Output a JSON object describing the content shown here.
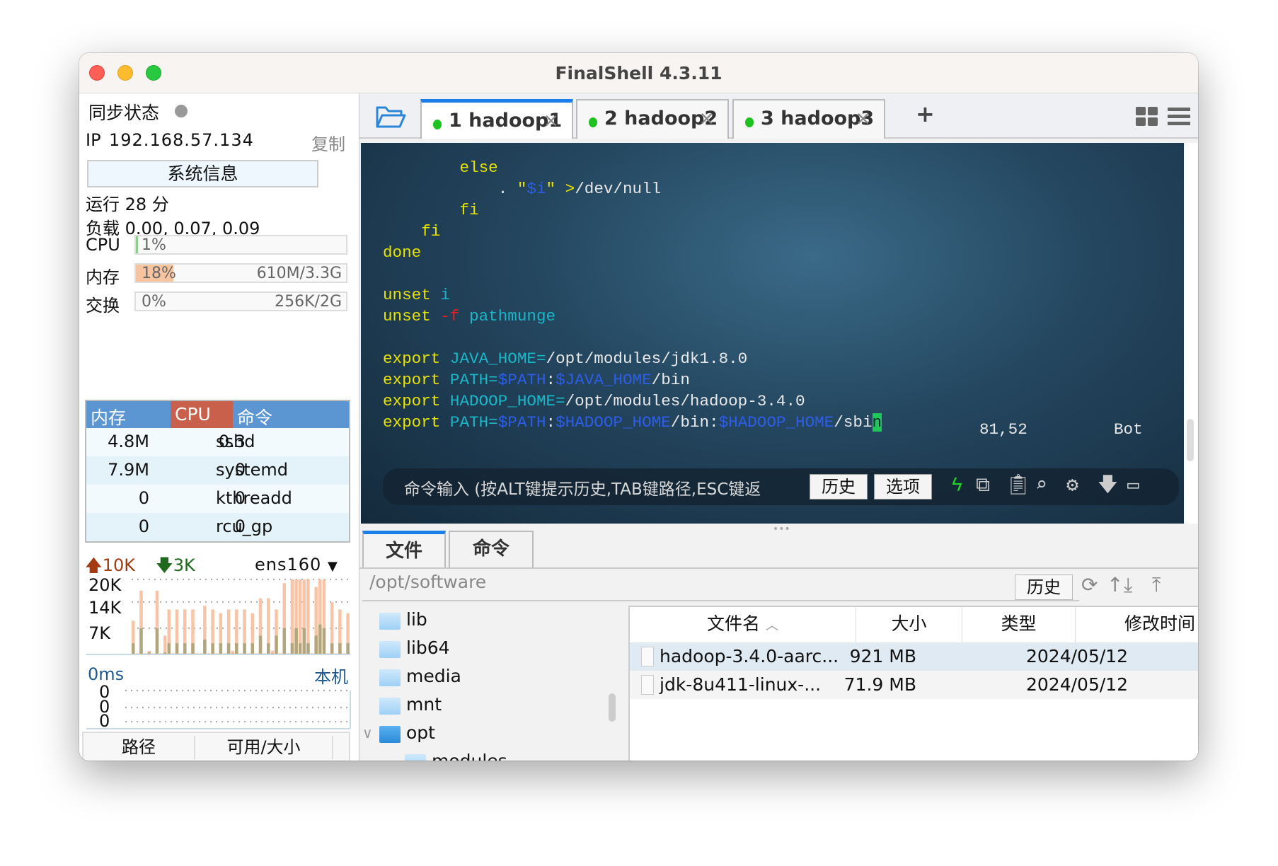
{
  "window": {
    "title": "FinalShell 4.3.11"
  },
  "left": {
    "sync_label": "同步状态",
    "ip_label": "IP",
    "ip": "192.168.57.134",
    "copy": "复制",
    "sysinfo_button": "系统信息",
    "uptime": "运行 28 分",
    "load": "负载 0.00, 0.07, 0.09",
    "cpu": {
      "label": "CPU",
      "percent": "1%",
      "fraction": 0.01
    },
    "mem": {
      "label": "内存",
      "percent": "18%",
      "fraction": 0.18,
      "amount": "610M/3.3G"
    },
    "swap": {
      "label": "交换",
      "percent": "0%",
      "fraction": 0,
      "amount": "256K/2G"
    },
    "process_table": {
      "headers": [
        "内存",
        "CPU",
        "命令"
      ],
      "rows": [
        [
          "4.8M",
          "0.3",
          "sshd"
        ],
        [
          "7.9M",
          "0",
          "systemd"
        ],
        [
          "0",
          "0",
          "kthreadd"
        ],
        [
          "0",
          "0",
          "rcu_gp"
        ]
      ]
    },
    "network": {
      "up": "10K",
      "down": "3K",
      "interface": "ens160",
      "y_ticks": [
        "20K",
        "14K",
        "7K"
      ],
      "upload": [
        9,
        0,
        17,
        0,
        1,
        0,
        17,
        0,
        5,
        12,
        0,
        12,
        0,
        12,
        0,
        12,
        0,
        0,
        13,
        0,
        12,
        0,
        11,
        0,
        12,
        1,
        12,
        0,
        12,
        0,
        11,
        0,
        15,
        0,
        15,
        1,
        12,
        0,
        19,
        0,
        20,
        20,
        20,
        20,
        20,
        0,
        18,
        20,
        20,
        0,
        14,
        0,
        12,
        0,
        11
      ],
      "download": [
        3,
        0,
        7,
        0,
        0.5,
        0,
        7,
        0,
        0.5,
        3,
        0,
        3,
        0,
        3,
        0,
        3,
        0,
        0,
        4,
        0,
        3,
        0,
        3,
        0,
        3,
        0.3,
        3,
        0,
        3,
        0,
        3,
        0,
        5,
        0,
        3,
        0.3,
        5,
        0,
        7,
        0,
        3,
        7,
        3,
        7,
        3,
        0,
        5,
        8,
        7,
        0,
        3,
        0,
        3,
        0,
        3
      ]
    },
    "latency": {
      "value": "0ms",
      "host": "本机",
      "y_ticks": [
        "0",
        "0",
        "0"
      ]
    },
    "disk_table": {
      "headers": [
        "路径",
        "可用/大小"
      ]
    }
  },
  "tabs": [
    {
      "num": "1",
      "name": "hadoop1",
      "active": true
    },
    {
      "num": "2",
      "name": "hadoop2"
    },
    {
      "num": "3",
      "name": "hadoop3"
    }
  ],
  "terminal": {
    "lines": [
      [
        [
          "        else",
          "y"
        ]
      ],
      [
        [
          "            . ",
          "w"
        ],
        [
          "\"",
          "y"
        ],
        [
          "$i",
          "b"
        ],
        [
          "\"",
          "y"
        ],
        [
          " >",
          "y"
        ],
        [
          "/dev/null",
          "w"
        ]
      ],
      [
        [
          "        fi",
          "y"
        ]
      ],
      [
        [
          "    fi",
          "y"
        ]
      ],
      [
        [
          "done",
          "y"
        ]
      ],
      [],
      [
        [
          "unset ",
          "y"
        ],
        [
          "i",
          "c"
        ]
      ],
      [
        [
          "unset ",
          "y"
        ],
        [
          "-f ",
          "r"
        ],
        [
          "pathmunge",
          "c"
        ]
      ],
      [],
      [
        [
          "export ",
          "y"
        ],
        [
          "JAVA_HOME=",
          "c"
        ],
        [
          "/opt/modules/jdk1.8.0",
          "w"
        ]
      ],
      [
        [
          "export ",
          "y"
        ],
        [
          "PATH=",
          "c"
        ],
        [
          "$PATH",
          "b"
        ],
        [
          ":",
          "w"
        ],
        [
          "$JAVA_HOME",
          "b"
        ],
        [
          "/bin",
          "w"
        ]
      ],
      [
        [
          "export ",
          "y"
        ],
        [
          "HADOOP_HOME=",
          "c"
        ],
        [
          "/opt/modules/hadoop-3.4.0",
          "w"
        ]
      ],
      [
        [
          "export ",
          "y"
        ],
        [
          "PATH=",
          "c"
        ],
        [
          "$PATH",
          "b"
        ],
        [
          ":",
          "w"
        ],
        [
          "$HADOOP_HOME",
          "b"
        ],
        [
          "/bin:",
          "w"
        ],
        [
          "$HADOOP_HOME",
          "b"
        ],
        [
          "/sbi",
          "w"
        ],
        [
          "n",
          "cursor"
        ]
      ]
    ],
    "status_pos": "81,52",
    "status_mode": "Bot",
    "command_placeholder": "命令输入 (按ALT键提示历史,TAB键路径,ESC键返",
    "history_button": "历史",
    "options_button": "选项"
  },
  "lower": {
    "tabs": [
      "文件",
      "命令"
    ],
    "path": "/opt/software",
    "history_button": "历史",
    "tree": [
      {
        "name": "lib",
        "level": 1
      },
      {
        "name": "lib64",
        "level": 1
      },
      {
        "name": "media",
        "level": 1
      },
      {
        "name": "mnt",
        "level": 1
      },
      {
        "name": "opt",
        "level": 1,
        "expanded": true
      },
      {
        "name": "modules",
        "level": 2
      }
    ],
    "file_headers": [
      "文件名",
      "大小",
      "类型",
      "修改时间"
    ],
    "files": [
      {
        "name": "hadoop-3.4.0-aarc...",
        "size": "921 MB",
        "type": "",
        "modified": "2024/05/12"
      },
      {
        "name": "jdk-8u411-linux-...",
        "size": "71.9 MB",
        "type": "",
        "modified": "2024/05/12"
      }
    ]
  },
  "colors": {
    "accent": "#1a7fe8",
    "upload": "#f8c4a8",
    "download": "#b3a57c",
    "header_blue": "#5b96d2",
    "header_cpu": "#c8604c",
    "status_green": "#1ec21e"
  }
}
